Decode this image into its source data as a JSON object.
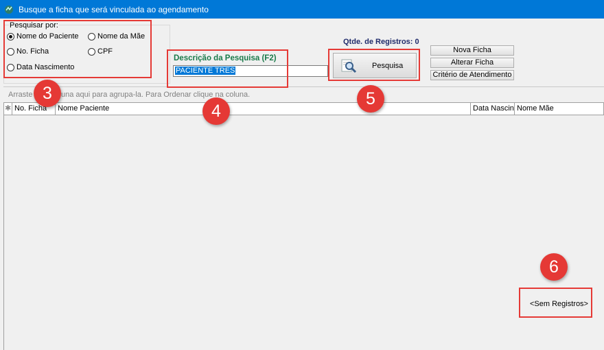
{
  "window": {
    "title": "Busque a ficha que será vinculada ao agendamento",
    "icon": "app-icon"
  },
  "search_by": {
    "label": "Pesquisar por:",
    "options": [
      {
        "label": "Nome do Paciente",
        "checked": true
      },
      {
        "label": "Nome da Mãe",
        "checked": false
      },
      {
        "label": "No. Ficha",
        "checked": false
      },
      {
        "label": "CPF",
        "checked": false
      },
      {
        "label": "Data Nascimento",
        "checked": false
      }
    ]
  },
  "search": {
    "label": "Descrição da Pesquisa (F2)",
    "value": "PACIENTE TRES"
  },
  "records": {
    "label": "Qtde. de Registros: 0"
  },
  "buttons": {
    "pesquisa": "Pesquisa",
    "nova_ficha": "Nova Ficha",
    "alterar_ficha": "Alterar Ficha",
    "criterio": "Critério de Atendimento"
  },
  "grid": {
    "group_hint": "Arraste uma coluna aqui para agrupa-la. Para Ordenar clique na coluna.",
    "columns": [
      "No. Ficha",
      "Nome Paciente",
      "Data Nascin",
      "Nome Mãe"
    ],
    "empty_text": "<Sem Registros>"
  },
  "callouts": [
    "3",
    "4",
    "5",
    "6"
  ],
  "colors": {
    "titlebar": "#0078d7",
    "highlight": "#e53935",
    "search_label": "#1a7a4a",
    "records_label": "#1f2b6b"
  }
}
